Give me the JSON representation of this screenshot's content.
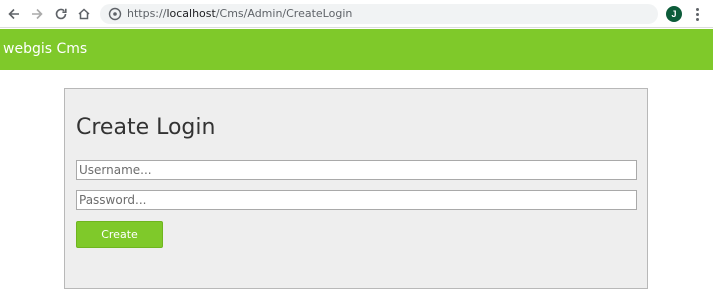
{
  "browser": {
    "url_prefix": "https://",
    "url_host": "localhost",
    "url_path": "/Cms/Admin/CreateLogin",
    "profile_initial": "J"
  },
  "app": {
    "brand": "webgis Cms",
    "accent_color": "#7fc92a"
  },
  "login_form": {
    "title": "Create Login",
    "username_placeholder": "Username...",
    "username_value": "",
    "password_placeholder": "Password...",
    "password_value": "",
    "create_label": "Create"
  }
}
